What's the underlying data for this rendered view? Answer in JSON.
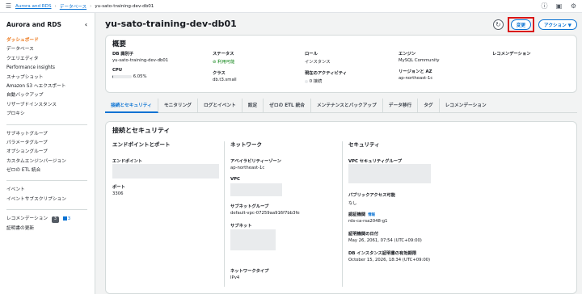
{
  "topbar": {
    "breadcrumb": [
      "Aurora and RDS",
      "データベース",
      "yu-sato-training-dev-db01"
    ],
    "icons": [
      "menu-icon",
      "info-circle-icon",
      "notifications-icon",
      "settings-icon"
    ]
  },
  "sidebar": {
    "title": "Aurora and RDS",
    "items_group1": [
      "ダッシュボード",
      "データベース",
      "クエリエディタ",
      "Performance insights",
      "スナップショット",
      "Amazon S3 へエクスポート",
      "自動バックアップ",
      "リザーブドインスタンス",
      "プロキシ"
    ],
    "items_group2": [
      "サブネットグループ",
      "パラメータグループ",
      "オプショングループ",
      "カスタムエンジンバージョン",
      "ゼロの ETL 統合"
    ],
    "items_group3": [
      "イベント",
      "イベントサブスクリプション"
    ],
    "recommendations_label": "レコメンデーション",
    "recommendations_badge": "3",
    "recommendations_badge2": "3",
    "cert_update": "証明書の更新"
  },
  "header": {
    "title": "yu-sato-training-dev-db01",
    "modify_label": "変更",
    "actions_label": "アクション ▼"
  },
  "summary": {
    "title": "概要",
    "db_id_label": "DB 識別子",
    "db_id_value": "yu-sato-training-dev-db01",
    "cpu_label": "CPU",
    "cpu_value": "6.05%",
    "cpu_fraction": 0.0605,
    "status_label": "ステータス",
    "status_value": "利用可能",
    "class_label": "クラス",
    "class_value": "db.t3.small",
    "role_label": "ロール",
    "role_value": "インスタンス",
    "activity_label": "現在のアクティビティ",
    "activity_value": "0 接続",
    "engine_label": "エンジン",
    "engine_value": "MySQL Community",
    "region_label": "リージョンと AZ",
    "region_value": "ap-northeast-1c",
    "recommend_label": "レコメンデーション"
  },
  "tabs": [
    "接続とセキュリティ",
    "モニタリング",
    "ログとイベント",
    "設定",
    "ゼロの ETL 統合",
    "メンテナンスとバックアップ",
    "データ移行",
    "タグ",
    "レコメンデーション"
  ],
  "connectivity": {
    "title": "接続とセキュリティ",
    "endpoint_section": "エンドポイントとポート",
    "endpoint_label": "エンドポイント",
    "port_label": "ポート",
    "port_value": "3306",
    "network_section": "ネットワーク",
    "az_label": "アベイラビリティーゾーン",
    "az_value": "ap-northeast-1c",
    "vpc_label": "VPC",
    "subnet_group_label": "サブネットグループ",
    "subnet_group_value": "default-vpc-07259aa916f7bb3fe",
    "subnet_label": "サブネット",
    "network_type_label": "ネットワークタイプ",
    "network_type_value": "IPv4",
    "security_section": "セキュリティ",
    "sg_label": "VPC セキュリティグループ",
    "public_label": "パブリックアクセス可能",
    "public_value": "なし",
    "ca_label": "認証機関",
    "ca_info": "情報",
    "ca_value": "rds-ca-rsa2048-g1",
    "ca_date_label": "証明機関の日付",
    "ca_date_value": "May 26, 2061, 07:54 (UTC+09:00)",
    "cert_exp_label": "DB インスタンス証明書の有効期限",
    "cert_exp_value": "October 15, 2026, 18:34 (UTC+09:00)"
  }
}
